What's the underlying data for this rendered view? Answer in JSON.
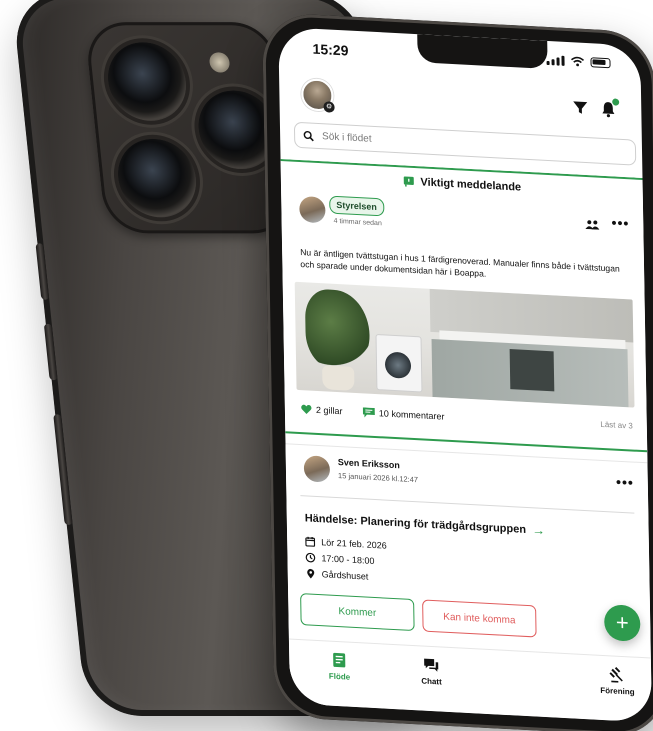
{
  "status_bar": {
    "time": "15:29"
  },
  "search": {
    "placeholder": "Sök i flödet"
  },
  "post1": {
    "important_label": "Viktigt meddelande",
    "author_tag": "Styrelsen",
    "time_ago": "4 timmar sedan",
    "body": "Nu är äntligen tvättstugan i hus 1 färdigrenoverad. Manualer finns både i tvättstugan och sparade under dokumentsidan här i Boappa.",
    "likes": "2 gillar",
    "comments": "10 kommentarer",
    "read_by": "Läst av 3"
  },
  "post2": {
    "author": "Sven Eriksson",
    "date": "15 januari 2026 kl.12:47",
    "event_title": "Händelse: Planering för trädgårdsgruppen",
    "event_date": "Lör 21 feb. 2026",
    "event_time": "17:00 - 18:00",
    "event_location": "Gårdshuset",
    "going_label": "Kommer",
    "not_going_label": "Kan inte komma"
  },
  "fab": {
    "label": "+"
  },
  "tabs": [
    {
      "label": "Flöde"
    },
    {
      "label": "Chatt"
    },
    {
      "label": "Förening"
    }
  ],
  "colors": {
    "accent": "#2e9b4e",
    "danger": "#e05d5d"
  }
}
